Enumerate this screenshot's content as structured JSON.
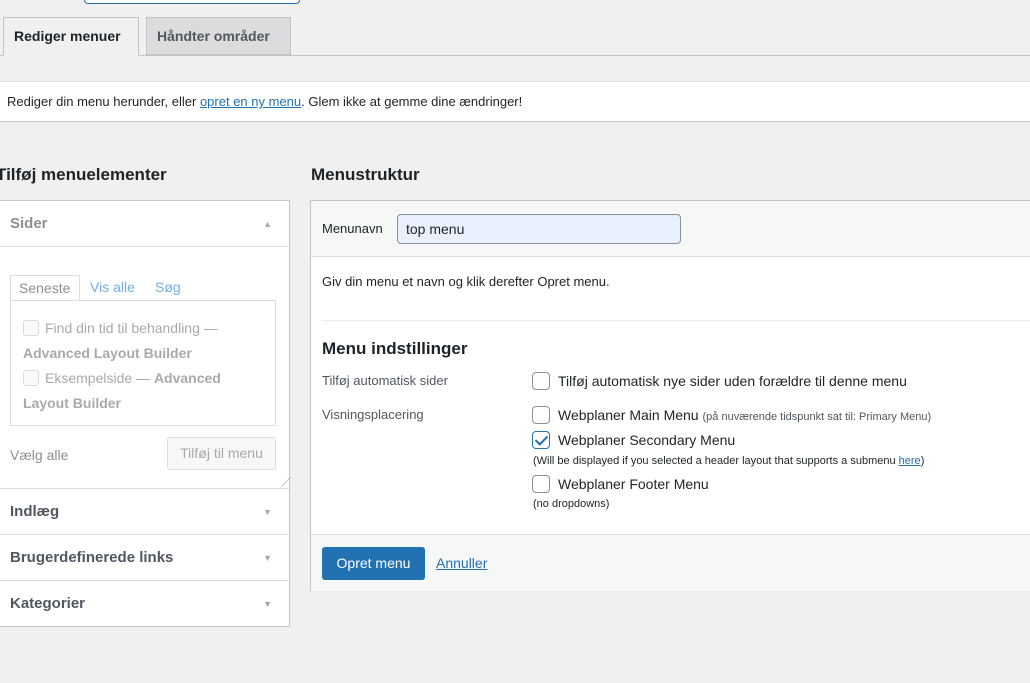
{
  "tabs": [
    {
      "label": "Rediger menuer"
    },
    {
      "label": "Håndter områder"
    }
  ],
  "notice": {
    "before": "Rediger din menu herunder, eller ",
    "link": "opret en ny menu",
    "after": ". Glem ikke at gemme dine ændringer!"
  },
  "left": {
    "title": "Tilføj menuelementer",
    "sections": [
      {
        "label": "Sider"
      },
      {
        "label": "Indlæg"
      },
      {
        "label": "Brugerdefinerede links"
      },
      {
        "label": "Kategorier"
      }
    ],
    "subtabs": [
      "Seneste",
      "Vis alle",
      "Søg"
    ],
    "pages": [
      {
        "title": "Find din tid til behandling",
        "sep": " — ",
        "builder": "Advanced Layout Builder"
      },
      {
        "title": "Eksempelside",
        "sep": " — ",
        "builder": "Advanced Layout Builder"
      }
    ],
    "select_all": "Vælg alle",
    "add_button": "Tilføj til menu"
  },
  "right": {
    "title": "Menustruktur",
    "menu_name_label": "Menunavn",
    "menu_name_value": "top menu",
    "hint": "Giv din menu et navn og klik derefter Opret menu.",
    "settings_title": "Menu indstillinger",
    "auto_add_label": "Tilføj automatisk sider",
    "auto_add_text": "Tilføj automatisk nye sider uden forældre til denne menu",
    "location_label": "Visningsplacering",
    "locations": [
      {
        "name": "Webplaner Main Menu",
        "extra": "(på nuværende tidspunkt sat til: Primary Menu)",
        "checked": false
      },
      {
        "name": "Webplaner Secondary Menu",
        "extra": "",
        "checked": true
      },
      {
        "name": "Webplaner Footer Menu",
        "extra": "",
        "checked": false
      }
    ],
    "secondary_note": "(Will be displayed if you selected a header layout that supports a submenu ",
    "secondary_note_link": "here",
    "secondary_note_end": ")",
    "footer_note": "(no dropdowns)",
    "create_button": "Opret menu",
    "cancel_link": "Annuller"
  },
  "colors": {
    "accent": "#2271b1",
    "background": "#f0f0f1"
  }
}
